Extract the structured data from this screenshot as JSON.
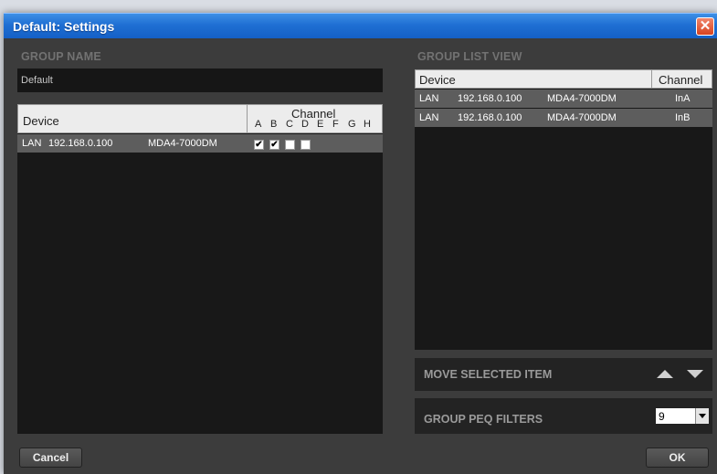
{
  "window": {
    "title": "Default: Settings",
    "close_glyph": "✕"
  },
  "group_name": {
    "label": "GROUP NAME",
    "value": "Default"
  },
  "device_table": {
    "col_device": "Device",
    "col_channel": "Channel",
    "channel_letters": [
      "A",
      "B",
      "C",
      "D",
      "E",
      "F",
      "G",
      "H"
    ],
    "rows": [
      {
        "type": "LAN",
        "ip": "192.168.0.100",
        "model": "MDA4-7000DM",
        "checked": [
          true,
          true,
          false,
          false
        ]
      }
    ]
  },
  "group_list": {
    "label": "GROUP LIST VIEW",
    "col_device": "Device",
    "col_channel": "Channel",
    "rows": [
      {
        "type": "LAN",
        "ip": "192.168.0.100",
        "model": "MDA4-7000DM",
        "channel": "InA"
      },
      {
        "type": "LAN",
        "ip": "192.168.0.100",
        "model": "MDA4-7000DM",
        "channel": "InB"
      }
    ]
  },
  "move_item": {
    "label": "MOVE SELECTED ITEM",
    "up_icon": "triangle-up-icon",
    "down_icon": "triangle-down-icon"
  },
  "peq": {
    "label": "GROUP PEQ FILTERS",
    "value": "9"
  },
  "buttons": {
    "cancel": "Cancel",
    "ok": "OK"
  },
  "colors": {
    "titlebar": "#1f6fd3",
    "background": "#3c3c3c",
    "panel": "#181818",
    "row": "#5d5d5d",
    "close": "#d8431f"
  }
}
